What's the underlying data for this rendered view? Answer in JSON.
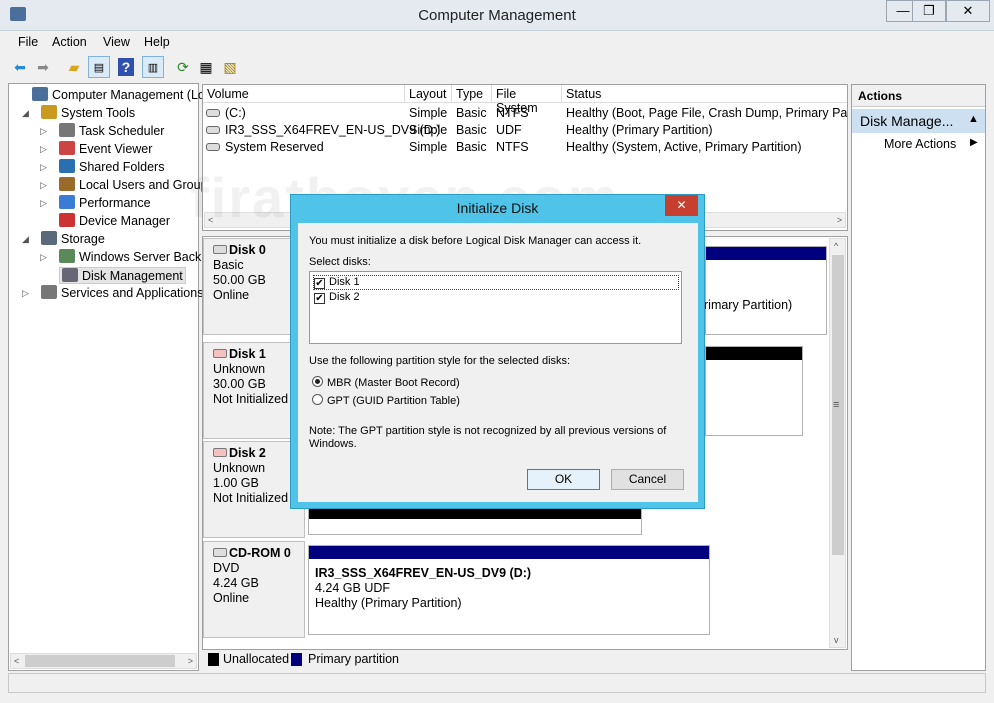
{
  "window": {
    "title": "Computer Management",
    "minimize": "—",
    "maximize": "❐",
    "close": "✕"
  },
  "menu": [
    "File",
    "Action",
    "View",
    "Help"
  ],
  "toolbar": [
    "back-icon",
    "forward-icon",
    "up-folder-icon",
    "show-hide-console-tree-icon",
    "help-icon",
    "show-hide-action-pane-icon",
    "refresh-icon",
    "properties-icon",
    "export-icon"
  ],
  "watermark": "firatboyan.com",
  "tree": [
    {
      "label": "Computer Management (Local",
      "level": 0
    },
    {
      "label": "System Tools",
      "level": 1,
      "expanded": true
    },
    {
      "label": "Task Scheduler",
      "level": 2
    },
    {
      "label": "Event Viewer",
      "level": 2
    },
    {
      "label": "Shared Folders",
      "level": 2
    },
    {
      "label": "Local Users and Groups",
      "level": 2
    },
    {
      "label": "Performance",
      "level": 2
    },
    {
      "label": "Device Manager",
      "level": 2
    },
    {
      "label": "Storage",
      "level": 1,
      "expanded": true
    },
    {
      "label": "Windows Server Backup",
      "level": 2
    },
    {
      "label": "Disk Management",
      "level": 2,
      "selected": true
    },
    {
      "label": "Services and Applications",
      "level": 1
    }
  ],
  "volumes": {
    "columns": [
      "Volume",
      "Layout",
      "Type",
      "File System",
      "Status"
    ],
    "rows": [
      [
        "(C:)",
        "Simple",
        "Basic",
        "NTFS",
        "Healthy (Boot, Page File, Crash Dump, Primary Partiti"
      ],
      [
        "IR3_SSS_X64FREV_EN-US_DV9 (D:)",
        "Simple",
        "Basic",
        "UDF",
        "Healthy (Primary Partition)"
      ],
      [
        "System Reserved",
        "Simple",
        "Basic",
        "NTFS",
        "Healthy (System, Active, Primary Partition)"
      ]
    ]
  },
  "disks": [
    {
      "name": "Disk 0",
      "type": "Basic",
      "size": "50.00 GB",
      "state": "Online",
      "partition_text": "rimary Partition)"
    },
    {
      "name": "Disk 1",
      "type": "Unknown",
      "size": "30.00 GB",
      "state": "Not Initialized"
    },
    {
      "name": "Disk 2",
      "type": "Unknown",
      "size": "1.00 GB",
      "state": "Not Initialized"
    },
    {
      "name": "CD-ROM 0",
      "type": "DVD",
      "size": "4.24 GB",
      "state": "Online",
      "partition": {
        "name": "IR3_SSS_X64FREV_EN-US_DV9  (D:)",
        "size": "4.24 GB UDF",
        "status": "Healthy (Primary Partition)"
      }
    }
  ],
  "legend": [
    {
      "label": "Unallocated",
      "color": "#000000"
    },
    {
      "label": "Primary partition",
      "color": "#00007f"
    }
  ],
  "actions": {
    "header": "Actions",
    "section": "Disk Manage...",
    "more": "More Actions"
  },
  "dialog": {
    "title": "Initialize Disk",
    "intro": "You must initialize a disk before Logical Disk Manager can access it.",
    "select_label": "Select disks:",
    "disks": [
      {
        "label": "Disk 1",
        "checked": true
      },
      {
        "label": "Disk 2",
        "checked": true
      }
    ],
    "style_label": "Use the following partition style for the selected disks:",
    "options": [
      {
        "label": "MBR (Master Boot Record)",
        "selected": true
      },
      {
        "label": "GPT (GUID Partition Table)",
        "selected": false
      }
    ],
    "note": "Note: The GPT partition style is not recognized by all previous versions of Windows.",
    "ok": "OK",
    "cancel": "Cancel",
    "close": "✕"
  },
  "colors": {
    "accent": "#4fc3e8",
    "primary_partition": "#00007f",
    "unallocated": "#000000",
    "close_red": "#c7402f",
    "selection": "#cde0f2"
  }
}
